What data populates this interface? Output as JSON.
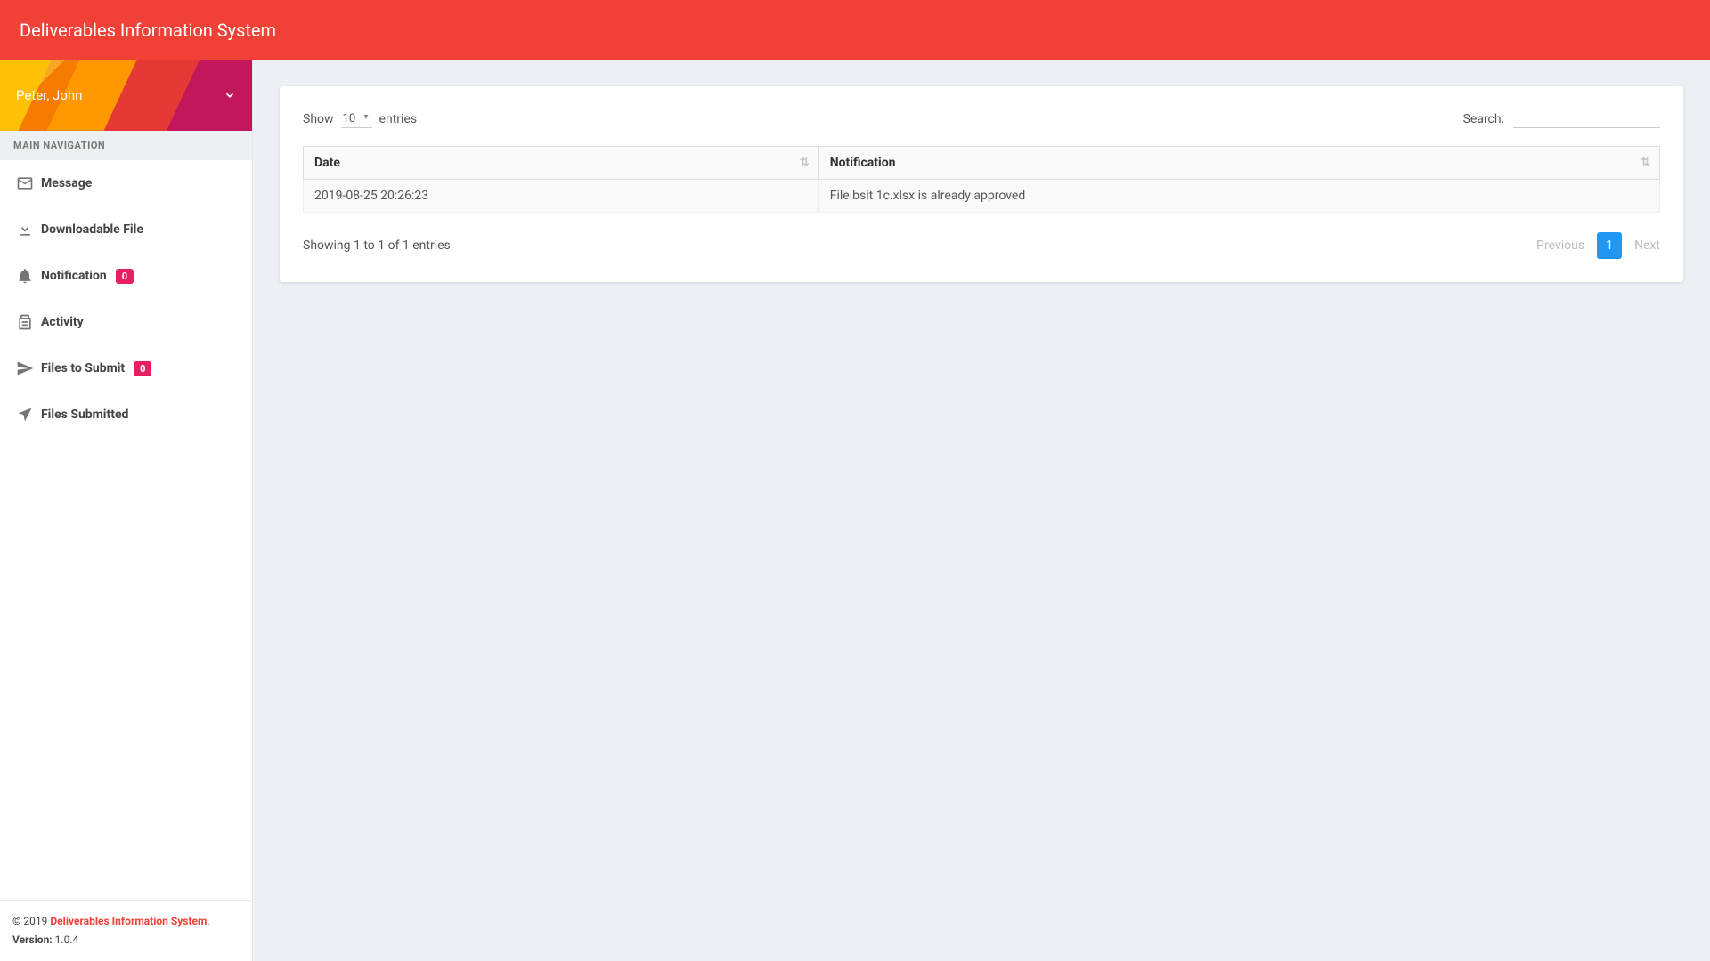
{
  "header": {
    "title": "Deliverables Information System"
  },
  "user": {
    "name": "Peter, John"
  },
  "sidebar": {
    "section_label": "MAIN NAVIGATION",
    "items": [
      {
        "label": "Message",
        "icon": "mail"
      },
      {
        "label": "Downloadable File",
        "icon": "download"
      },
      {
        "label": "Notification",
        "icon": "bell",
        "badge": "0"
      },
      {
        "label": "Activity",
        "icon": "clipboard"
      },
      {
        "label": "Files to Submit",
        "icon": "send",
        "badge": "0"
      },
      {
        "label": "Files Submitted",
        "icon": "location"
      }
    ]
  },
  "datatable": {
    "length": {
      "pre": "Show",
      "value": "10",
      "post": "entries"
    },
    "search_label": "Search:",
    "search_value": "",
    "columns": [
      "Date",
      "Notification"
    ],
    "rows": [
      {
        "date": "2019-08-25 20:26:23",
        "notification": "File bsit 1c.xlsx is already approved"
      }
    ],
    "info": "Showing 1 to 1 of 1 entries",
    "pager": {
      "prev": "Previous",
      "next": "Next",
      "pages": [
        "1"
      ],
      "current": "1"
    }
  },
  "footer": {
    "copyright_pre": "© 2019 ",
    "link": "Deliverables Information System",
    "copyright_post": ".",
    "version_label": "Version:",
    "version": " 1.0.4"
  }
}
